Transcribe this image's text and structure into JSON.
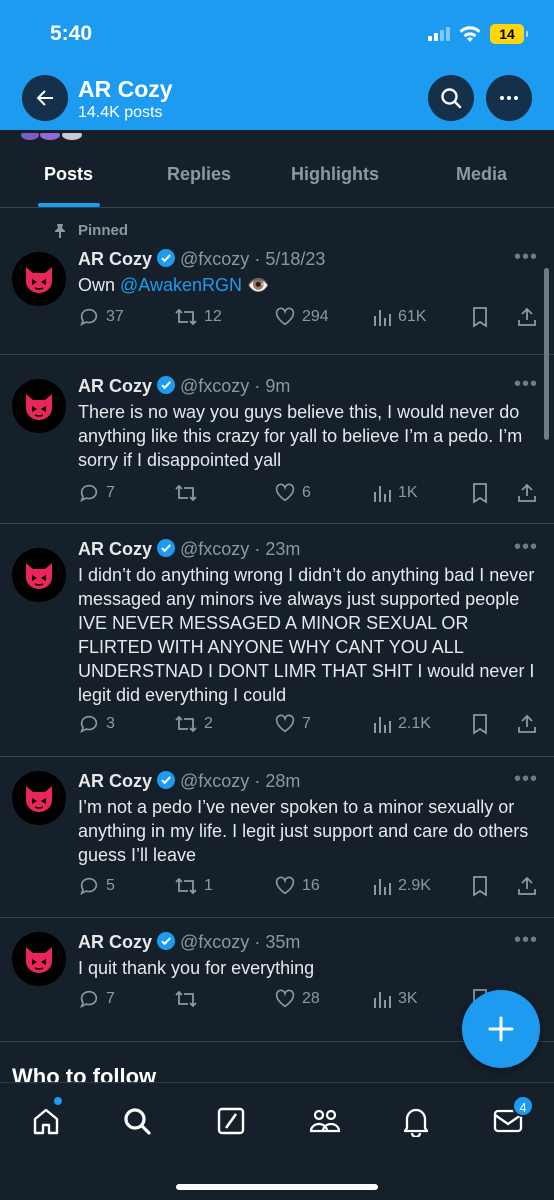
{
  "status_bar": {
    "time": "5:40",
    "battery": "14"
  },
  "header": {
    "title": "AR Cozy",
    "subtitle": "14.4K posts"
  },
  "tabs": [
    {
      "label": "Posts",
      "active": true
    },
    {
      "label": "Replies",
      "active": false
    },
    {
      "label": "Highlights",
      "active": false
    },
    {
      "label": "Media",
      "active": false
    }
  ],
  "pinned_label": "Pinned",
  "tweets": [
    {
      "name": "AR Cozy",
      "handle": "@fxcozy",
      "time": "· 5/18/23",
      "text_prefix": "Own ",
      "mention": "@AwakenRGN",
      "replies": "37",
      "reposts": "12",
      "likes": "294",
      "views": "61K"
    },
    {
      "name": "AR Cozy",
      "handle": "@fxcozy",
      "time": "· 9m",
      "text": "There is no way you guys believe this, I would never do anything like this crazy for yall to believe I’m a pedo. I’m sorry if I disappointed yall",
      "replies": "7",
      "reposts": "",
      "likes": "6",
      "views": "1K"
    },
    {
      "name": "AR Cozy",
      "handle": "@fxcozy",
      "time": "· 23m",
      "text": "I didn’t do anything wrong I didn’t do anything bad I never messaged any minors ive always just supported people IVE NEVER MESSAGED A MINOR SEXUAL OR FLIRTED WITH ANYONE WHY CANT YOU ALL UNDERSTNAD I DONT LIMR THAT SHIT I would never I legit did everything I could",
      "replies": "3",
      "reposts": "2",
      "likes": "7",
      "views": "2.1K"
    },
    {
      "name": "AR Cozy",
      "handle": "@fxcozy",
      "time": "· 28m",
      "text": "I’m not a pedo I’ve never spoken to a minor sexually or anything in my life. I legit just support and care do others guess I’ll leave",
      "replies": "5",
      "reposts": "1",
      "likes": "16",
      "views": "2.9K"
    },
    {
      "name": "AR Cozy",
      "handle": "@fxcozy",
      "time": "· 35m",
      "text": "I quit thank you for everything",
      "replies": "7",
      "reposts": "",
      "likes": "28",
      "views": "3K"
    }
  ],
  "who_to_follow": "Who to follow",
  "nav": {
    "messages_badge": "4"
  },
  "colors": {
    "accent": "#1d9bf0",
    "background": "#15202b",
    "avatar_cat": "#e8265a"
  }
}
